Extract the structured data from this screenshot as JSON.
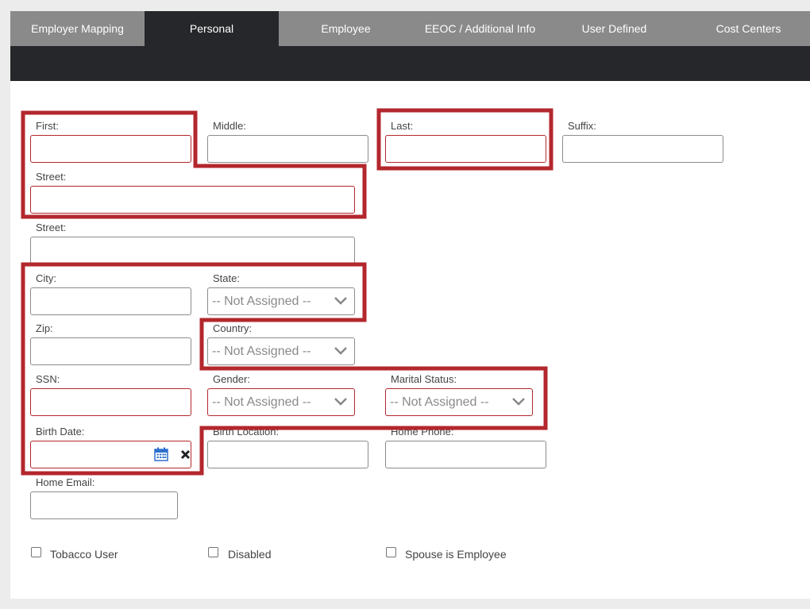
{
  "tabs": [
    {
      "label": "Employer Mapping"
    },
    {
      "label": "Personal"
    },
    {
      "label": "Employee"
    },
    {
      "label": "EEOC / Additional Info"
    },
    {
      "label": "User Defined"
    },
    {
      "label": "Cost Centers"
    }
  ],
  "active_tab": "Personal",
  "form": {
    "first_label": "First:",
    "middle_label": "Middle:",
    "last_label": "Last:",
    "suffix_label": "Suffix:",
    "street1_label": "Street:",
    "street2_label": "Street:",
    "city_label": "City:",
    "state_label": "State:",
    "state_value": "-- Not Assigned --",
    "zip_label": "Zip:",
    "country_label": "Country:",
    "country_value": "-- Not Assigned --",
    "ssn_label": "SSN:",
    "gender_label": "Gender:",
    "gender_value": "-- Not Assigned --",
    "marital_label": "Marital Status:",
    "marital_value": "-- Not Assigned --",
    "birthdate_label": "Birth Date:",
    "birthlocation_label": "Birth Location:",
    "homephone_label": "Home Phone:",
    "homeemail_label": "Home Email:"
  },
  "checkboxes": {
    "tobacco_label": "Tobacco User",
    "disabled_label": "Disabled",
    "spouse_label": "Spouse is Employee"
  },
  "colors": {
    "tab_bar": "#8a8a8a",
    "active_tab": "#25272a",
    "required_border": "#b3272d",
    "annotation": "#b3272d",
    "calendar_icon": "#2d6fcf"
  },
  "icons": {
    "select_arrow": "chevron-down-icon",
    "date_picker": "calendar-icon",
    "clear": "close-icon"
  }
}
